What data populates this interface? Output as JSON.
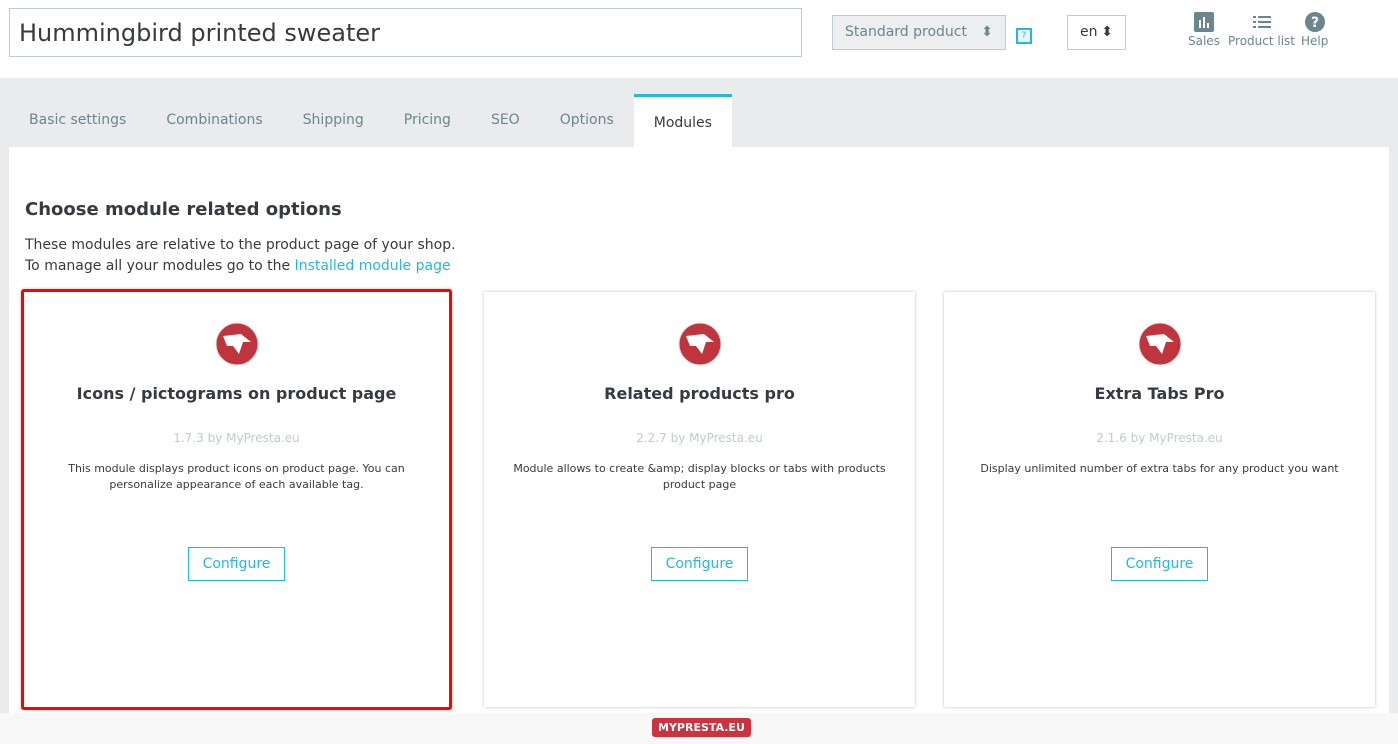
{
  "header": {
    "product_name": "Hummingbird printed sweater",
    "product_type": "Standard product",
    "help_badge": "?",
    "language": "en",
    "tools": [
      {
        "label": "Sales",
        "icon": "bar-chart-icon"
      },
      {
        "label": "Product list",
        "icon": "list-icon"
      },
      {
        "label": "Help",
        "icon": "help-icon"
      }
    ]
  },
  "tabs": [
    "Basic settings",
    "Combinations",
    "Shipping",
    "Pricing",
    "SEO",
    "Options",
    "Modules"
  ],
  "active_tab": "Modules",
  "main": {
    "heading": "Choose module related options",
    "intro_line1": "These modules are relative to the product page of your shop.",
    "intro_line2": "To manage all your modules go to the ",
    "intro_link": "Installed module page",
    "modules": [
      {
        "title": "Icons / pictograms on product page",
        "version": "1.7.3 by MyPresta.eu",
        "description": "This module displays product icons on product page. You can personalize appearance of each available tag.",
        "button": "Configure",
        "selected": true
      },
      {
        "title": "Related products pro",
        "version": "2.2.7 by MyPresta.eu",
        "description": "Module allows to create &amp; display blocks or tabs with products product page",
        "button": "Configure",
        "selected": false
      },
      {
        "title": "Extra Tabs Pro",
        "version": "2.1.6 by MyPresta.eu",
        "description": "Display unlimited number of extra tabs for any product you want",
        "button": "Configure",
        "selected": false
      }
    ]
  },
  "footer": {
    "badge": "MYPRESTA.EU"
  },
  "colors": {
    "accent": "#25b9d7",
    "selection": "#ff0000",
    "brand": "#c9343f"
  }
}
